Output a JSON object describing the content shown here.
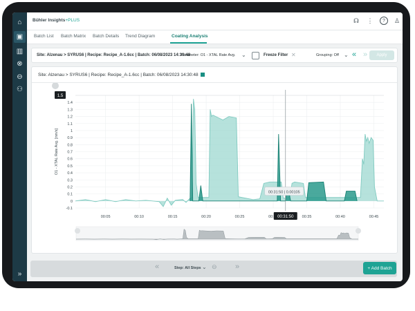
{
  "app": {
    "logo_text": "Bühler Insights",
    "logo_suffix": "PLUS"
  },
  "sidebar": {
    "items": [
      {
        "icon": "home-icon",
        "glyph": "⌂"
      },
      {
        "icon": "batch-icon",
        "glyph": "▣"
      },
      {
        "icon": "factory-icon",
        "glyph": "▥"
      },
      {
        "icon": "cancel-circle-icon",
        "glyph": "⊗"
      },
      {
        "icon": "minus-circle-icon",
        "glyph": "⊖"
      },
      {
        "icon": "users-icon",
        "glyph": "⚇"
      },
      {
        "icon": "expand-icon",
        "glyph": "»"
      }
    ]
  },
  "topbar": {
    "icons": [
      "headset-icon",
      "more-vert-icon",
      "help-icon",
      "user-icon"
    ],
    "glyphs": [
      "☊",
      "⋮",
      "?",
      "♙"
    ]
  },
  "tabs": [
    "Batch List",
    "Batch Matrix",
    "Batch Details",
    "Trend Diagram",
    "Coating Analysis"
  ],
  "active_tab": "Coating Analysis",
  "filter": {
    "breadcrumb": "Site: Alzenau > SYRUS6 | Recipe: Recipe_A-1.6cc | Batch: 06/08/2023 14:30:48",
    "parameter_label": "Parameter: O1 - XTAL Rate Avg.",
    "freeze_label": "Freeze Filter",
    "grouping_label": "Grouping: Off",
    "apply_label": "Apply"
  },
  "panel": {
    "title": "Site: Alzenau > SYRUS6 | Recipe: Recipe_A-1.6cc | Batch: 06/08/2023 14:30:48"
  },
  "chart_data": {
    "type": "area",
    "ylabel": "O1 - XTAL Rate Avg. [nm/s]",
    "yticks": [
      1.4,
      1.3,
      1.2,
      1.1,
      1.0,
      0.9,
      0.8,
      0.7,
      0.6,
      0.5,
      0.4,
      0.3,
      0.2,
      0.1,
      0,
      -0.1
    ],
    "ylim": [
      -0.1,
      1.5
    ],
    "xticks": [
      "00:05",
      "00:10",
      "00:15",
      "00:20",
      "00:25",
      "00:30",
      "00:35",
      "00:40",
      "00:45"
    ],
    "xlim_minutes": [
      0.5,
      46.5
    ],
    "cursor_y_label": "1.5",
    "cursor_x_label": "00:31:50",
    "tooltip": "00:31:50 | 0.00105",
    "series": [
      {
        "points": [
          [
            0.5,
            0.0
          ],
          [
            2,
            0.02
          ],
          [
            3.5,
            -0.01
          ],
          [
            5,
            0.02
          ],
          [
            6.5,
            -0.01
          ],
          [
            8,
            0.02
          ],
          [
            9.5,
            0.0
          ],
          [
            11,
            0.01
          ],
          [
            13,
            -0.01
          ],
          [
            13.6,
            -0.08
          ],
          [
            14.2,
            0.04
          ],
          [
            14.8,
            -0.06
          ],
          [
            15.4,
            0.01
          ],
          [
            16.5,
            0.02
          ],
          [
            17,
            -0.02
          ],
          [
            17.5,
            0.03
          ],
          [
            17.9,
            0.05
          ],
          [
            18.1,
            1.45
          ],
          [
            18.3,
            1.3
          ],
          [
            18.5,
            0.25
          ],
          [
            18.8,
            0.05
          ],
          [
            20.4,
            0.05
          ],
          [
            20.6,
            1.3
          ],
          [
            20.8,
            1.2
          ],
          [
            21,
            1.22
          ],
          [
            22.5,
            1.15
          ],
          [
            23.4,
            1.2
          ],
          [
            24.5,
            1.18
          ],
          [
            24.8,
            0.06
          ],
          [
            27,
            0.02
          ],
          [
            28,
            0.03
          ],
          [
            28.6,
            0.25
          ],
          [
            29.5,
            0.27
          ],
          [
            31.2,
            0.27
          ],
          [
            31.5,
            0.04
          ],
          [
            31.9,
            0.04
          ],
          [
            32.5,
            0.06
          ],
          [
            32.8,
            0.25
          ],
          [
            33.2,
            0.27
          ],
          [
            34.5,
            0.25
          ],
          [
            34.8,
            0.05
          ],
          [
            40.5,
            0.05
          ],
          [
            43,
            0.05
          ],
          [
            43.3,
            0.6
          ],
          [
            43.5,
            0.52
          ],
          [
            43.7,
            0.95
          ],
          [
            43.9,
            0.85
          ],
          [
            44.1,
            0.9
          ],
          [
            44.3,
            0.82
          ],
          [
            44.6,
            0.9
          ],
          [
            44.9,
            0.86
          ],
          [
            45.1,
            0.2
          ],
          [
            45.5,
            0.0
          ],
          [
            46.5,
            0.0
          ]
        ]
      },
      {
        "points": [
          [
            17.6,
            0.0
          ],
          [
            17.8,
            1.38
          ],
          [
            18.0,
            0.0
          ],
          [
            18.9,
            0.0
          ],
          [
            19.2,
            0.22
          ],
          [
            19.5,
            0.0
          ],
          [
            30.6,
            0.0
          ],
          [
            30.8,
            0.95
          ],
          [
            31.1,
            0.0
          ],
          [
            31.8,
            0.0
          ],
          [
            32.1,
            0.18
          ],
          [
            32.3,
            0.14
          ],
          [
            32.6,
            0.0
          ],
          [
            35.0,
            0.0
          ],
          [
            35.3,
            0.26
          ],
          [
            37.5,
            0.27
          ],
          [
            37.9,
            0.0
          ],
          [
            40.6,
            0.0
          ],
          [
            40.9,
            0.14
          ],
          [
            42.2,
            0.14
          ],
          [
            42.5,
            0.0
          ]
        ]
      }
    ]
  },
  "footer": {
    "step_label": "Step: All Steps",
    "add_label": "+ Add Batch"
  },
  "colors": {
    "accent": "#1ea394",
    "dark_teal": "#177f72",
    "area_fill": "#8fd3cb",
    "rail": "#1d3a46"
  }
}
